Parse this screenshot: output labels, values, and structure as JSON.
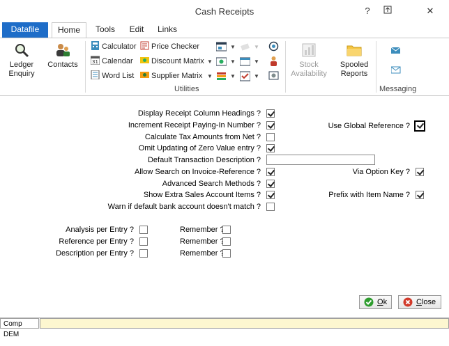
{
  "window": {
    "title": "Cash Receipts",
    "help": "?",
    "close": "✕"
  },
  "tabs": [
    "Datafile",
    "Home",
    "Tools",
    "Edit",
    "Links"
  ],
  "ribbon": {
    "ledger_enquiry": [
      "Ledger",
      "Enquiry"
    ],
    "contacts": "Contacts",
    "calculator": "Calculator",
    "calendar": "Calendar",
    "word_list": "Word List",
    "price_checker": "Price Checker",
    "discount_matrix": "Discount Matrix",
    "supplier_matrix": "Supplier Matrix",
    "stock_availability": [
      "Stock",
      "Availability"
    ],
    "spooled_reports": [
      "Spooled",
      "Reports"
    ],
    "utilities_label": "Utilities",
    "messaging_label": "Messaging"
  },
  "options": [
    {
      "label": "Display Receipt Column Headings ?",
      "checked": true
    },
    {
      "label": "Increment Receipt Paying-In Number ?",
      "checked": true
    },
    {
      "label": "Calculate Tax Amounts from Net ?",
      "checked": false
    },
    {
      "label": "Omit Updating of Zero Value entry ?",
      "checked": true
    },
    {
      "label": "Default Transaction Description ?",
      "value": ""
    },
    {
      "label": "Allow Search on Invoice-Reference ?",
      "checked": true
    },
    {
      "label": "Advanced Search Methods ?",
      "checked": true
    },
    {
      "label": "Show Extra Sales Account Items ?",
      "checked": true
    },
    {
      "label": "Warn if default bank account doesn't match ?",
      "checked": false
    }
  ],
  "right_options": [
    {
      "label": "Use Global Reference ?",
      "checked": true
    },
    {
      "label": "Via Option Key ?",
      "checked": true
    },
    {
      "label": "Prefix with Item Name ?",
      "checked": true
    }
  ],
  "entry_options": [
    {
      "label": "Analysis per Entry ?",
      "checked": false,
      "remember": "Remember ?",
      "remember_checked": false
    },
    {
      "label": "Reference per Entry ?",
      "checked": false,
      "remember": "Remember ?",
      "remember_checked": false
    },
    {
      "label": "Description per Entry ?",
      "checked": false,
      "remember": "Remember ?",
      "remember_checked": false
    }
  ],
  "buttons": {
    "ok_pre": "",
    "ok_key": "O",
    "ok_post": "k",
    "close_pre": "",
    "close_key": "C",
    "close_post": "lose"
  },
  "status": {
    "company": "Comp DEM",
    "message": ""
  },
  "colors": {
    "file_tab": "#1e6dc8",
    "ok_icon": "#2e9d2e",
    "close_icon": "#d23a2a"
  }
}
